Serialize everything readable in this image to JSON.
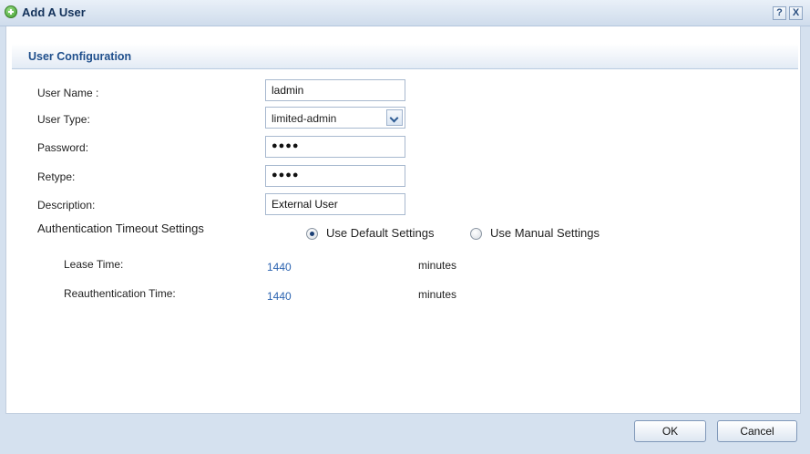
{
  "window": {
    "title": "Add A User",
    "help_glyph": "?",
    "close_glyph": "X"
  },
  "section": {
    "title": "User Configuration"
  },
  "form": {
    "user_name_label": "User Name :",
    "user_name_value": "ladmin",
    "user_type_label": "User Type:",
    "user_type_value": "limited-admin",
    "password_label": "Password:",
    "password_value": "●●●●",
    "retype_label": "Retype:",
    "retype_value": "●●●●",
    "description_label": "Description:",
    "description_value": "External User"
  },
  "auth": {
    "label": "Authentication Timeout Settings",
    "options": [
      {
        "label": "Use Default Settings",
        "selected": true
      },
      {
        "label": "Use Manual Settings",
        "selected": false
      }
    ],
    "lease_label": "Lease Time:",
    "lease_value": "1440",
    "lease_unit": "minutes",
    "reauth_label": "Reauthentication Time:",
    "reauth_value": "1440",
    "reauth_unit": "minutes"
  },
  "buttons": {
    "ok": "OK",
    "cancel": "Cancel"
  },
  "colors": {
    "accent": "#1f4f8c",
    "link_value": "#2b63b0",
    "frame": "#d5e1ef"
  }
}
